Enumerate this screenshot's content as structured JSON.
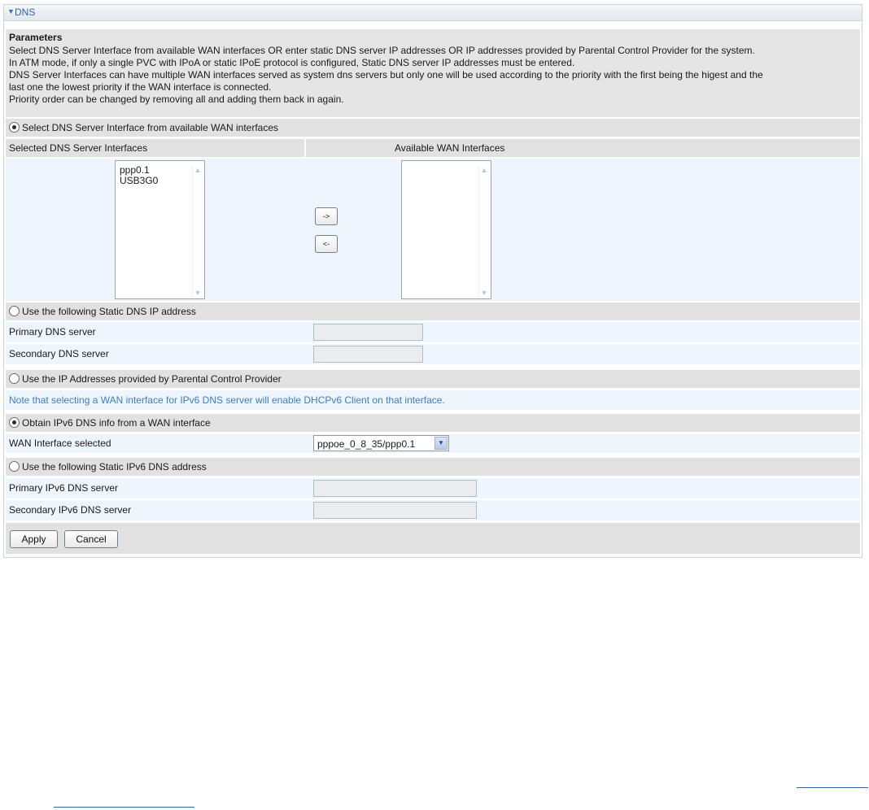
{
  "panel": {
    "title": "DNS"
  },
  "params": {
    "heading": "Parameters",
    "lines": [
      "Select DNS Server Interface from available WAN interfaces OR enter static DNS server IP addresses OR IP addresses provided by Parental Control Provider for the system.",
      "In ATM mode, if only a single PVC with IPoA or static IPoE protocol is configured, Static DNS server IP addresses must be entered.",
      "DNS Server Interfaces can have multiple WAN interfaces served as system dns servers but only one will be used according to the priority with the first being the higest and the",
      "last one the lowest priority if the WAN interface is connected.",
      "Priority order can be changed by removing all and adding them back in again."
    ]
  },
  "dns_interface_option": {
    "label": "Select DNS Server Interface from available WAN interfaces",
    "selected": true
  },
  "interfaces": {
    "selected_header": "Selected DNS Server Interfaces",
    "available_header": "Available WAN Interfaces",
    "selected_items": [
      "ppp0.1",
      "USB3G0"
    ],
    "available_items": [],
    "add_button": "->",
    "remove_button": "<-"
  },
  "static_dns_option": {
    "label": "Use the following Static DNS IP address",
    "selected": false
  },
  "static_dns": {
    "primary_label": "Primary DNS server",
    "secondary_label": "Secondary DNS server",
    "primary_value": "",
    "secondary_value": ""
  },
  "parental_option": {
    "label": "Use the IP Addresses provided by Parental Control Provider",
    "selected": false
  },
  "ipv6_note": "Note that selecting a WAN interface for IPv6 DNS server will enable DHCPv6 Client on that interface.",
  "ipv6_wan_option": {
    "label": "Obtain IPv6 DNS info from a WAN interface",
    "selected": true
  },
  "wan_interface": {
    "label": "WAN Interface selected",
    "value": "pppoe_0_8_35/ppp0.1"
  },
  "ipv6_static_option": {
    "label": "Use the following Static IPv6 DNS address",
    "selected": false
  },
  "ipv6_static": {
    "primary_label": "Primary IPv6 DNS server",
    "secondary_label": "Secondary IPv6 DNS server",
    "primary_value": "",
    "secondary_value": ""
  },
  "actions": {
    "apply": "Apply",
    "cancel": "Cancel"
  },
  "colors": {
    "title": "#2f66b5",
    "note": "#3b7fc3",
    "row_gray": "#e1e1e1",
    "row_blue": "#eef5fc"
  }
}
